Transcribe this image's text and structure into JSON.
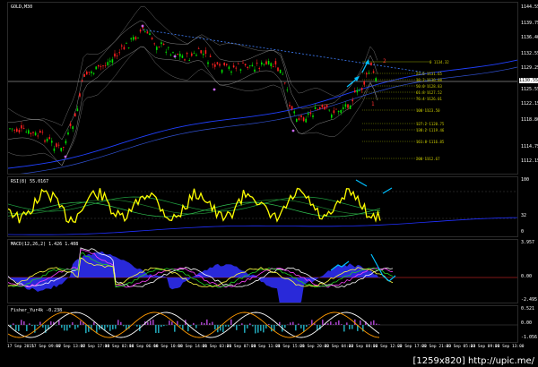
{
  "colors": {
    "background": "#000000",
    "bull_candle": "#00e000",
    "bear_candle": "#ff2020",
    "rsi_line": "#ffff00",
    "macd_hist": "#3030ff",
    "fisher_line": "#ff9900",
    "arrow": "#00bfff"
  },
  "main_pane": {
    "title": "GOLD,M30",
    "price_levels": [
      "1144.55",
      "1139.75",
      "1136.40",
      "1132.55",
      "1129.25",
      "1125.55",
      "1122.15",
      "1118.80",
      "1114.75",
      "1112.15"
    ],
    "current_price": "1130.55",
    "fib_labels": [
      "0 1134.32",
      "23.6 1131.65",
      "38.2 1130.08",
      "50.0 1128.83",
      "61.8 1127.52",
      "76.4 1126.01",
      "100 1123.50",
      "127.2 1120.75",
      "138.2 1119.46",
      "161.8 1116.85",
      "200 1112.67"
    ],
    "wave_labels": [
      "2",
      "1"
    ]
  },
  "rsi_pane": {
    "title": "RSI(8) 55.0167",
    "levels": [
      "100",
      "32",
      "0"
    ]
  },
  "macd_pane": {
    "title": "MACD(12,26,2) 1.426 1.408",
    "levels": [
      "3.957",
      "0.00",
      "-2.495"
    ]
  },
  "fisher_pane": {
    "title": "Fisher_Yur4k -0.238",
    "levels": [
      "0.521",
      "0.00",
      "-1.056"
    ]
  },
  "time_axis": [
    "17 Sep 2015",
    "17 Sep 09:00",
    "17 Sep 13:00",
    "17 Sep 17:00",
    "18 Sep 02:00",
    "18 Sep 06:00",
    "18 Sep 10:00",
    "18 Sep 14:00",
    "21 Sep 03:00",
    "21 Sep 07:00",
    "21 Sep 11:00",
    "21 Sep 15:00",
    "21 Sep 20:00",
    "22 Sep 04:00",
    "22 Sep 08:00",
    "22 Sep 12:00",
    "22 Sep 17:00",
    "22 Sep 21:00",
    "23 Sep 05:00",
    "23 Sep 09:00",
    "23 Sep 13:00"
  ],
  "watermark": "[1259x820] http://upic.me/"
}
